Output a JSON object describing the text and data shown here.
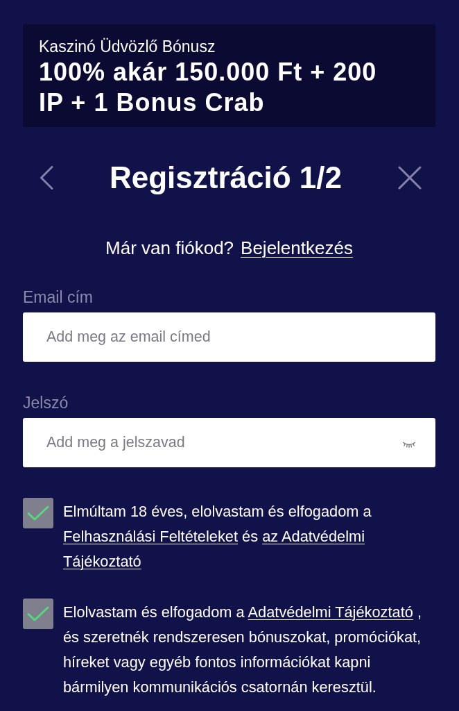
{
  "banner": {
    "subtitle": "Kaszinó Üdvözlő Bónusz",
    "title": "100% akár 150.000 Ft + 200 IP + 1 Bonus Crab"
  },
  "header": {
    "title": "Regisztráció 1/2"
  },
  "login_prompt": {
    "text": "Már van fiókod?",
    "link": "Bejelentkezés"
  },
  "fields": [
    {
      "kind": "email",
      "label": "Email cím",
      "placeholder": "Add meg az email címed"
    },
    {
      "kind": "password",
      "label": "Jelszó",
      "placeholder": "Add meg a jelszavad"
    }
  ],
  "consents": [
    {
      "checked": true,
      "parts": [
        {
          "kind": "text",
          "text": "Elmúltam 18 éves, elolvastam és elfogadom a "
        },
        {
          "kind": "link",
          "text": "Felhasználási Feltételeket"
        },
        {
          "kind": "text",
          "text": " és "
        },
        {
          "kind": "link",
          "text": "az Adatvédelmi"
        },
        {
          "kind": "link",
          "text": "Tájékoztató"
        }
      ]
    },
    {
      "checked": true,
      "parts": [
        {
          "kind": "text",
          "text": "Elolvastam és elfogadom a "
        },
        {
          "kind": "link",
          "text": "Adatvédelmi Tájékoztató"
        },
        {
          "kind": "text",
          "text": " , és szeretnék rendszeresen bónuszokat, promóciókat, híreket vagy egyéb fontos információkat kapni bármilyen kommunikációs csatornán keresztül."
        }
      ]
    }
  ]
}
